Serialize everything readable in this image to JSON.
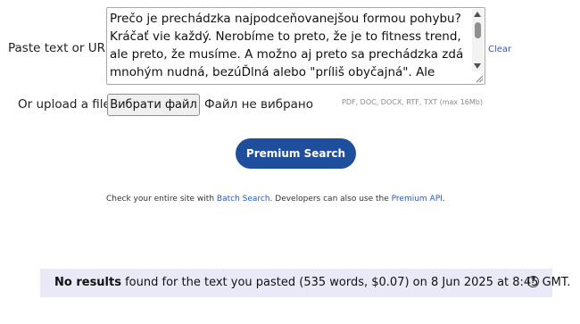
{
  "paste": {
    "label": "Paste text or URL:",
    "textarea_value": "Prečo je prechádzka najpodceňovanejšou formou pohybu?\nKráčať vie každý. Nerobíme to preto, že je to fitness trend, ale preto, že musíme. A možno aj preto sa prechádzka zdá mnohým nudná, bezúĎlná alebo \"príliš obyčajná\". Ale chyba lávky. Práve v tejto",
    "clear_label": "Clear"
  },
  "upload": {
    "label": "Or upload a file:",
    "button_label": "Вибрати файл",
    "status": "Файл не вибрано",
    "formats_note": "PDF, DOC, DOCX, RTF, TXT (max 16Mb)"
  },
  "search": {
    "button_label": "Premium Search"
  },
  "info": {
    "prefix": "Check your entire site with ",
    "batch_link": "Batch Search",
    "middle": ". Developers can also use the ",
    "api_link": "Premium API",
    "suffix": "."
  },
  "result": {
    "bold": "No results",
    "text": " found for the text you pasted (535 words, $0.07) on 8 Jun 2025 at 8:45 GMT.",
    "help_symbol": "?"
  },
  "colors": {
    "accent": "#1f4f9c",
    "link": "#2f5ab0",
    "banner_bg": "#e9e9f7"
  }
}
